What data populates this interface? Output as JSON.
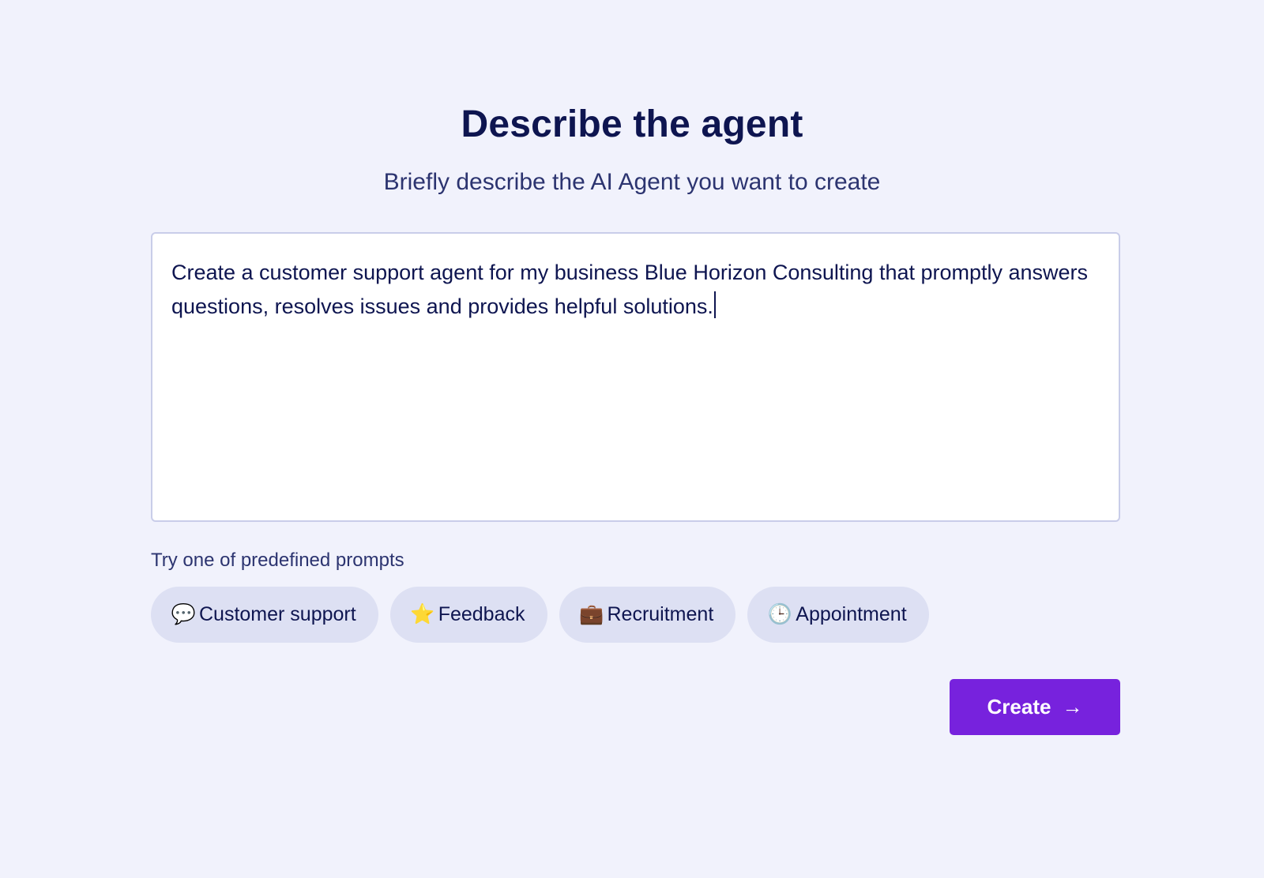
{
  "page": {
    "title": "Describe the agent",
    "subtitle": "Briefly describe the AI Agent you want to create"
  },
  "editor": {
    "value": "Create a customer support agent for my business Blue Horizon Consulting that promptly answers questions, resolves issues and provides helpful solutions."
  },
  "prompts": {
    "label": "Try one of predefined prompts",
    "chips": [
      {
        "icon": "speech-bubble-icon",
        "glyph": "💬",
        "label": "Customer support"
      },
      {
        "icon": "star-icon",
        "glyph": "⭐",
        "label": "Feedback"
      },
      {
        "icon": "briefcase-icon",
        "glyph": "💼",
        "label": "Recruitment"
      },
      {
        "icon": "clock-icon",
        "glyph": "🕒",
        "label": "Appointment"
      }
    ]
  },
  "actions": {
    "create_label": "Create",
    "create_icon": "arrow-right-icon"
  },
  "colors": {
    "background": "#f1f2fc",
    "text": "#0e1550",
    "chip": "#dde0f3",
    "accent": "#7722dd"
  }
}
